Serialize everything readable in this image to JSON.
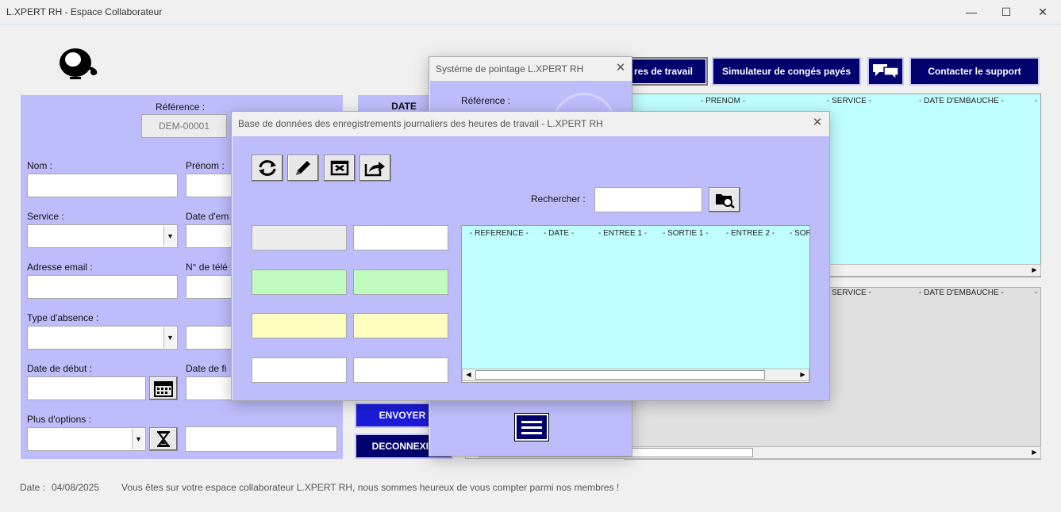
{
  "window": {
    "title": "L.XPERT RH - Espace Collaborateur",
    "minimize": "—",
    "maximize": "☐",
    "close": "✕"
  },
  "form": {
    "reference_label": "Référence :",
    "reference_value": "DEM-00001",
    "nom_label": "Nom :",
    "prenom_label": "Prénom :",
    "service_label": "Service :",
    "date_embauche_label": "Date d'em",
    "email_label": "Adresse email :",
    "phone_label": "N° de télé",
    "absence_label": "Type d'absence :",
    "date_debut_label": "Date de début :",
    "date_fin_label": "Date de fi",
    "options_label": "Plus d'options :"
  },
  "middle": {
    "date_header": "DATE",
    "envoyer": "ENVOYER",
    "deconnexion": "DECONNEXIO"
  },
  "nav": {
    "heures": "res de travail",
    "simulateur": "Simulateur de congés payés",
    "support": "Contacter le support"
  },
  "list_top": {
    "headers": [
      "- PRENOM -",
      "- SERVICE -",
      "- DATE D'EMBAUCHE -",
      "-"
    ]
  },
  "list_bottom": {
    "headers": [
      "SERVICE -",
      "- DATE D'EMBAUCHE -",
      "-"
    ]
  },
  "dialog_pointage": {
    "title": "Système de pointage L.XPERT RH",
    "reference_label": "Référence :"
  },
  "dialog_db": {
    "title": "Base de données des enregistrements journaliers des heures de travail - L.XPERT RH",
    "search_label": "Rechercher :",
    "headers": [
      "- REFERENCE -",
      "- DATE -",
      "- ENTREE 1 -",
      "- SORTIE 1 -",
      "- ENTREE 2 -",
      "- SOR"
    ]
  },
  "footer": {
    "date_label": "Date :",
    "date_value": "04/08/2025",
    "message": "Vous êtes sur votre espace collaborateur L.XPERT RH, nous sommes heureux de vous compter parmi nos membres !"
  },
  "colors": {
    "panel": "#bdbdfc",
    "navy": "#02026e",
    "list_cyan": "#c0ffff",
    "green_field": "#c0fcc0",
    "yellow_field": "#fdfdc0"
  },
  "icons": [
    "headset-icon",
    "refresh-icon",
    "pencil-icon",
    "delete-icon",
    "export-icon",
    "search-folder-icon",
    "calendar-icon",
    "hourglass-icon",
    "chat-icon",
    "menu-icon"
  ]
}
